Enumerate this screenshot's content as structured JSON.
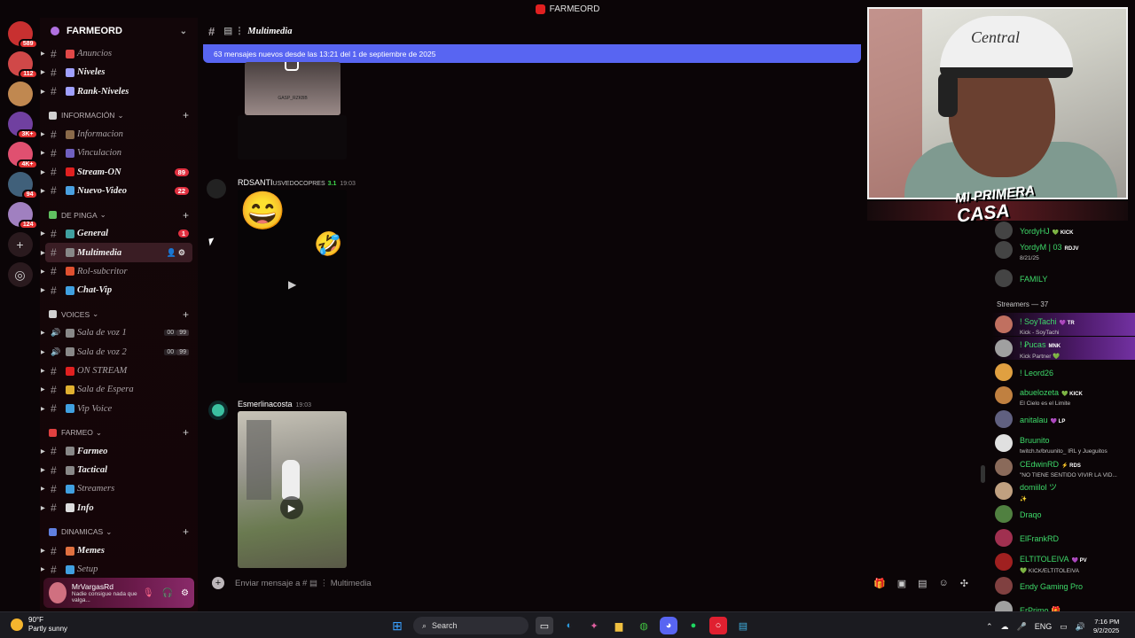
{
  "window": {
    "title": "FARMEORD"
  },
  "servers": [
    {
      "badge": "589",
      "color": "#c83030"
    },
    {
      "badge": "112",
      "color": "#d04848"
    },
    {
      "badge": "",
      "color": "#c08850"
    },
    {
      "badge": "3K+",
      "color": "#7040a0"
    },
    {
      "badge": "4K+",
      "color": "#e05070"
    },
    {
      "badge": "94",
      "color": "#40607a"
    },
    {
      "badge": "124",
      "color": "#a080c0"
    }
  ],
  "guild": {
    "name": "FARMEORD"
  },
  "sidebar": {
    "channels_top": [
      {
        "label": "Anuncios",
        "dim": true,
        "color": "#e04848"
      },
      {
        "label": "Niveles",
        "dim": false,
        "color": "#a0a0ff"
      },
      {
        "label": "Rank-Niveles",
        "dim": false,
        "color": "#a0a0ff"
      }
    ],
    "categories": [
      {
        "name": "INFORMACIÓN",
        "color": "#d0d0d0",
        "channels": [
          {
            "label": "Informacion",
            "dim": true,
            "color": "#8a6a4a"
          },
          {
            "label": "Vinculacion",
            "dim": true,
            "color": "#7060c0"
          },
          {
            "label": "Stream-ON",
            "dim": false,
            "color": "#e02020",
            "count": "89"
          },
          {
            "label": "Nuevo-Video",
            "dim": false,
            "color": "#4aa0e0",
            "count": "22"
          }
        ]
      },
      {
        "name": "DE PINGA",
        "color": "#60c060",
        "channels": [
          {
            "label": "General",
            "dim": false,
            "color": "#40a0a0",
            "count": "1"
          },
          {
            "label": "Multimedia",
            "dim": false,
            "color": "#888888",
            "active": true
          },
          {
            "label": "Rol-subcritor",
            "dim": true,
            "color": "#e05030"
          },
          {
            "label": "Chat-Vip",
            "dim": false,
            "color": "#40a0e0"
          }
        ]
      },
      {
        "name": "VOICES",
        "color": "#d0d0d0",
        "channels": [
          {
            "label": "Sala de voz 1",
            "dim": true,
            "color": "#888888",
            "voice": [
              "00",
              "99"
            ]
          },
          {
            "label": "Sala de voz 2",
            "dim": true,
            "color": "#888888",
            "voice": [
              "00",
              "99"
            ]
          },
          {
            "label": "ON STREAM",
            "dim": true,
            "color": "#e02020"
          },
          {
            "label": "Sala de Espera",
            "dim": true,
            "color": "#e0b030"
          },
          {
            "label": "Vip Voice",
            "dim": true,
            "color": "#40a0e0"
          }
        ]
      },
      {
        "name": "FARMEO",
        "color": "#e04040",
        "channels": [
          {
            "label": "Farmeo",
            "dim": false,
            "color": "#888888"
          },
          {
            "label": "Tactical",
            "dim": false,
            "color": "#888888"
          },
          {
            "label": "Streamers",
            "dim": true,
            "color": "#40a0e0"
          },
          {
            "label": "Info",
            "dim": false,
            "color": "#dddddd"
          }
        ]
      },
      {
        "name": "DINAMICAS",
        "color": "#6080e0",
        "channels": [
          {
            "label": "Memes",
            "dim": false,
            "color": "#e07040"
          },
          {
            "label": "Setup",
            "dim": true,
            "color": "#40a0e0"
          }
        ]
      }
    ]
  },
  "user": {
    "name": "MrVargasRd",
    "status": "Nadie consigue nada que valga..."
  },
  "channel": {
    "name": "Multimedia",
    "banner": "63 mensajes nuevos desde las 13:21 del 1 de septiembre de 2025",
    "media_top_caption": "GASP_RZKBB"
  },
  "messages": [
    {
      "author": "RDSANTI",
      "tag": "USVEDOCOPRES",
      "level": "3.1",
      "time": "19:03"
    },
    {
      "author": "Esmerlinacosta",
      "time": "19:03"
    }
  ],
  "composer": {
    "placeholder": "Enviar mensaje a # ▤ ⋮ Multimedia"
  },
  "overlay": {
    "cap_text": "Central",
    "brand_line1": "MI PRIMERA",
    "brand_line2": "CASA"
  },
  "members": {
    "top": [
      {
        "name": "YordyHJ",
        "badge": "💚 KICK",
        "sub": ""
      },
      {
        "name": "YordyM | 03",
        "badge": "RDJV",
        "sub": "8/21/25"
      },
      {
        "name": "FAMILY",
        "badge": "",
        "sub": ""
      }
    ],
    "section": "Streamers — 37",
    "list": [
      {
        "name": "! SoyTachi",
        "badge": "💜 TR",
        "sub": "Kick - SoyTachi",
        "color": "#c07060",
        "hl": true
      },
      {
        "name": "! Ꝑucas",
        "badge": "MNK",
        "sub": "Kick Partner 💚",
        "color": "#a0a0a0",
        "hl": true
      },
      {
        "name": "! Leord26",
        "badge": "",
        "sub": "",
        "color": "#e0a040"
      },
      {
        "name": "abuelozeta",
        "badge": "💚 KICK",
        "sub": "El Cielo es el Limite",
        "color": "#c08040"
      },
      {
        "name": "anitalau",
        "badge": "💜 LP",
        "sub": "",
        "color": "#606080"
      },
      {
        "name": "Bruunito",
        "badge": "",
        "sub": "twitch.tv/bruunito_ IRL y Jueguitos",
        "color": "#e0e0e0"
      },
      {
        "name": "CEdwinRD",
        "badge": "⚡ RDS",
        "sub": "\"NO TIENE SENTIDO VIVIR LA VID...",
        "color": "#8a6a5a"
      },
      {
        "name": "domiilol ツ",
        "badge": "",
        "sub": "✨",
        "color": "#c0a080"
      },
      {
        "name": "Draqo",
        "badge": "",
        "sub": "",
        "color": "#508040"
      },
      {
        "name": "ElFrankRD",
        "badge": "",
        "sub": "",
        "color": "#a03050"
      },
      {
        "name": "ELTITOLEIVA",
        "badge": "💜 PV",
        "sub": "💚 KICK/ELTITOLEIVA",
        "color": "#a02020"
      },
      {
        "name": "Endy Gaming Pro",
        "badge": "",
        "sub": "",
        "color": "#804040"
      },
      {
        "name": "ErPrimo 🎁",
        "badge": "",
        "sub": "",
        "color": "#a0a0a0"
      }
    ]
  },
  "taskbar": {
    "weather_temp": "90°F",
    "weather_desc": "Partly sunny",
    "search": "Search",
    "lang": "ENG",
    "time": "7:16 PM",
    "date": "9/2/2025"
  }
}
